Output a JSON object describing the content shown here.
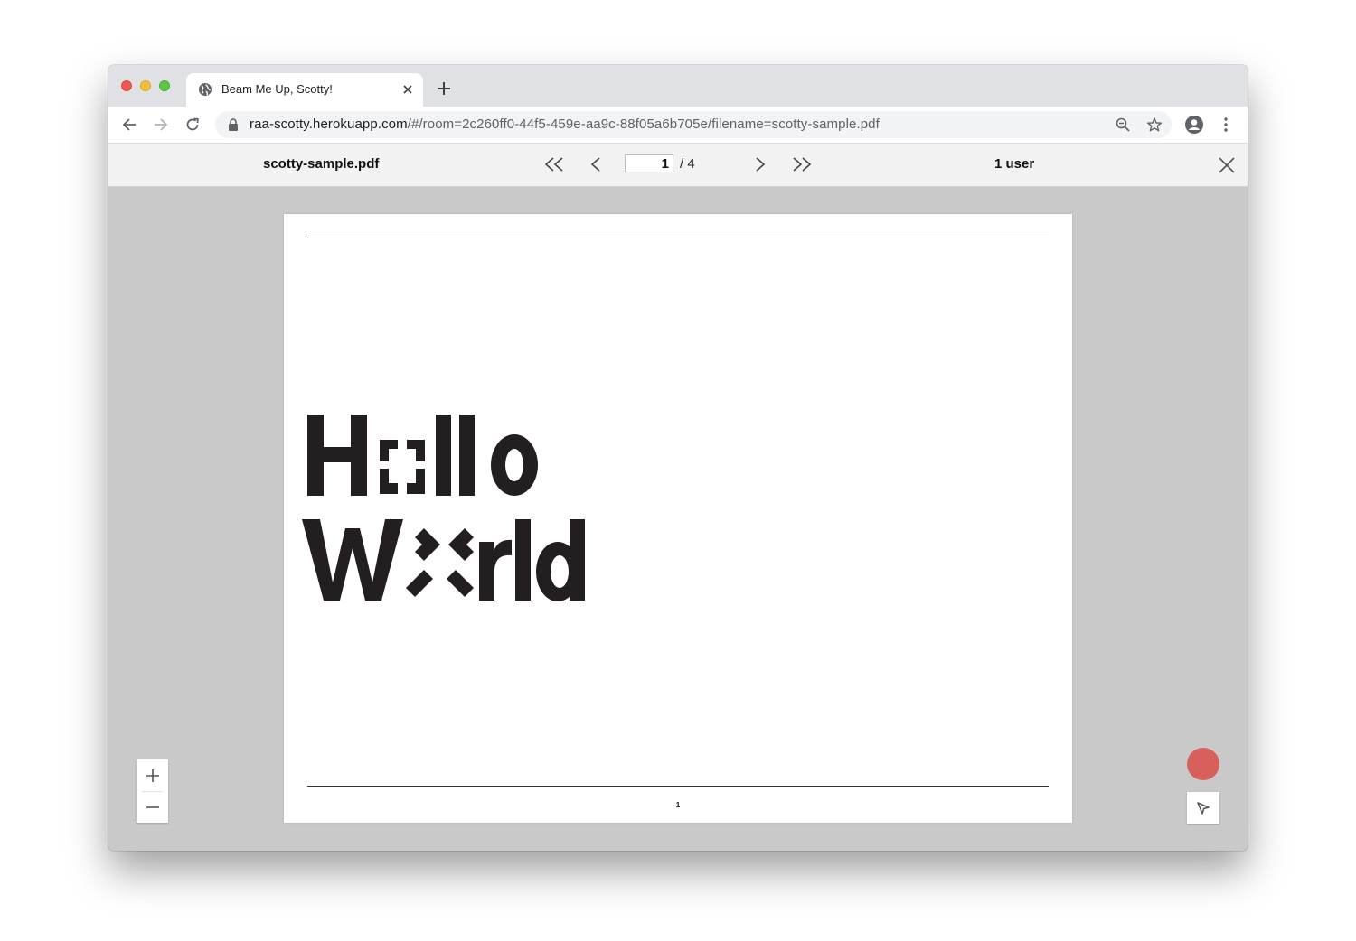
{
  "browser": {
    "tab_title": "Beam Me Up, Scotty!",
    "tab_icon": "globe-icon",
    "url_host": "raa-scotty.herokuapp.com",
    "url_path": "/#/room=2c260ff0-44f5-459e-aa9c-88f05a6b705e/filename=scotty-sample.pdf"
  },
  "viewer": {
    "filename": "scotty-sample.pdf",
    "current_page": "1",
    "total_pages": "/ 4",
    "users": "1 user"
  },
  "document": {
    "logo_text": "Hello World",
    "page_number": "1"
  },
  "colors": {
    "record": "#d9534f",
    "viewer_bg": "#c9c9c9",
    "header_bg": "#f2f2f2"
  }
}
